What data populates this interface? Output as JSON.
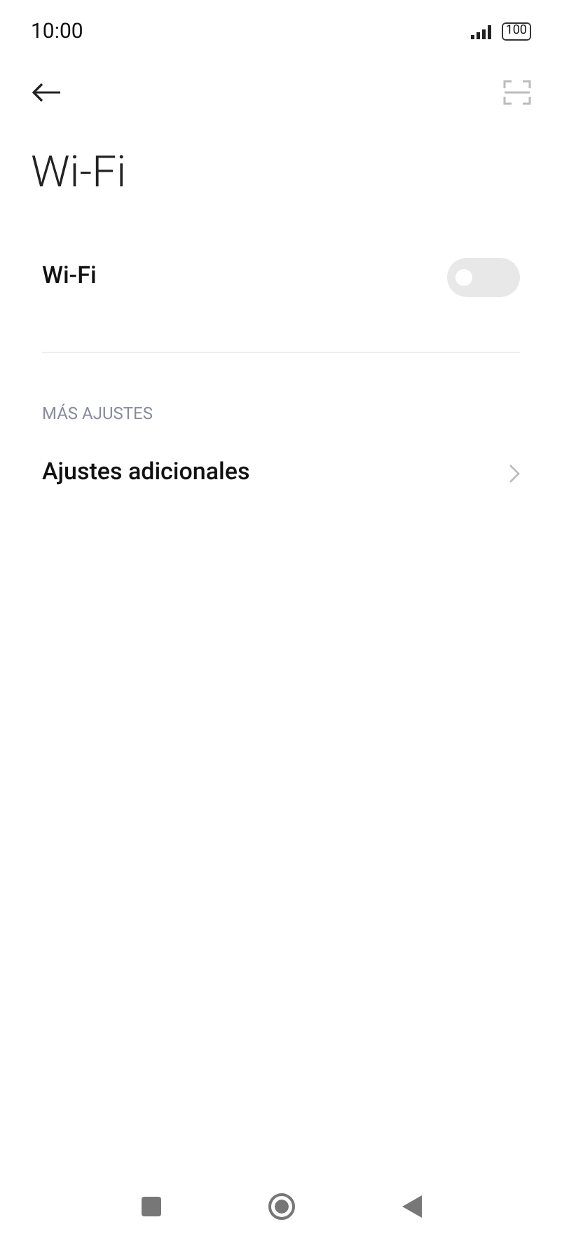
{
  "status_bar": {
    "time": "10:00",
    "battery": "100"
  },
  "title": "Wi-Fi",
  "wifi_toggle": {
    "label": "Wi-Fi",
    "on": false
  },
  "section": {
    "header": "MÁS AJUSTES",
    "items": [
      {
        "label": "Ajustes adicionales"
      }
    ]
  }
}
